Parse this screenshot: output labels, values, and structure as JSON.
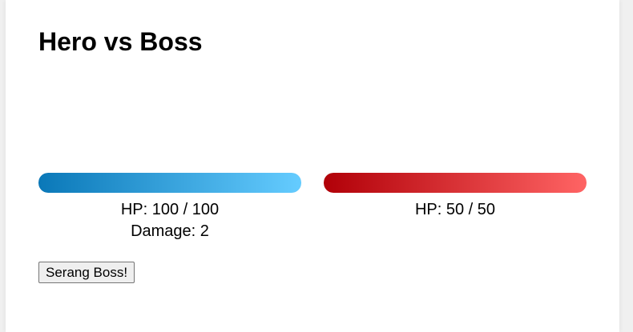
{
  "title": "Hero vs Boss",
  "hero": {
    "hp_text": "HP: 100 / 100",
    "damage_text": "Damage: 2",
    "hp_fraction": 1.0,
    "color_start": "#0a78b8",
    "color_end": "#65ccff"
  },
  "boss": {
    "hp_text": "HP: 50 / 50",
    "hp_fraction": 1.0,
    "color_start": "#b10008",
    "color_end": "#ff6464"
  },
  "actions": {
    "attack_label": "Serang Boss!"
  }
}
